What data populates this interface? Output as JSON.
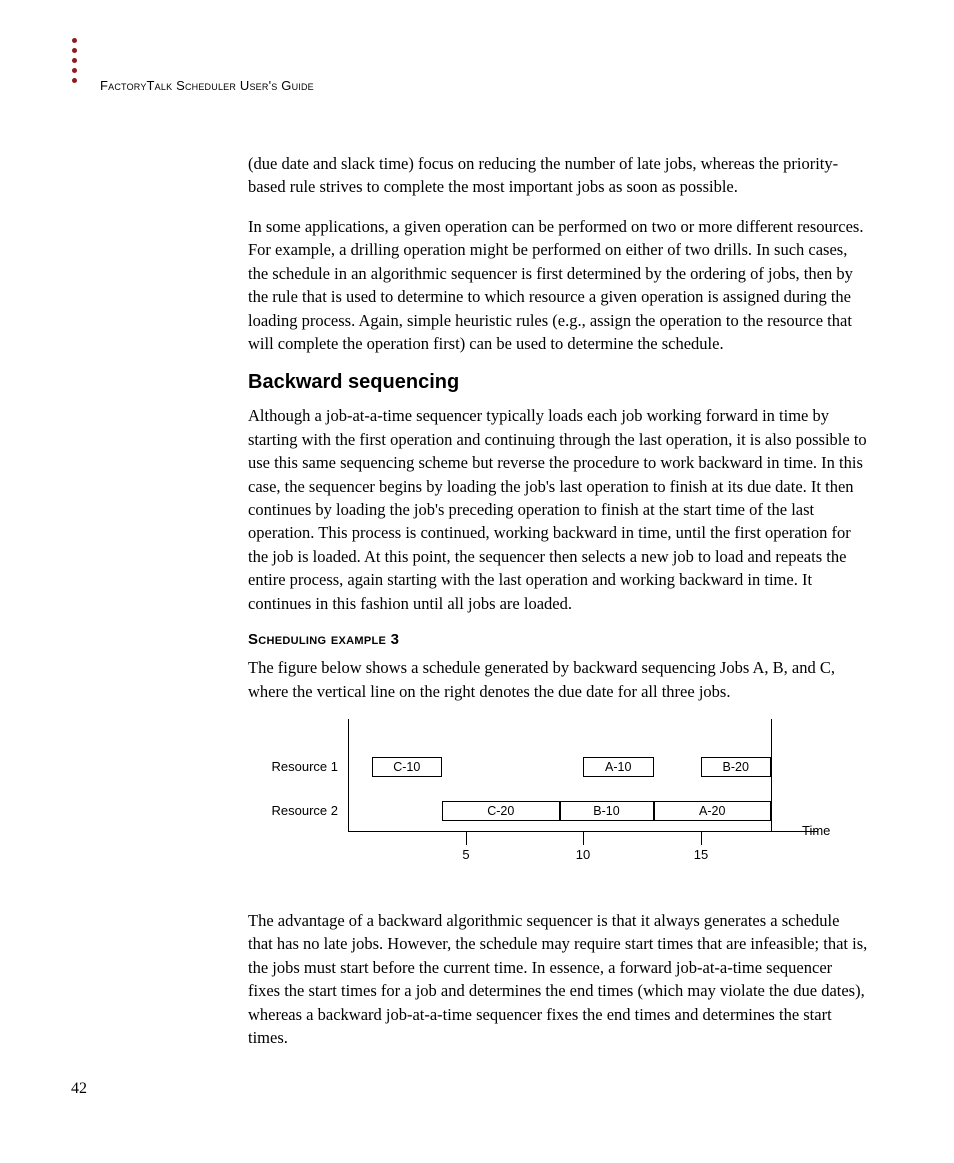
{
  "header": {
    "title": "FactoryTalk Scheduler User's Guide"
  },
  "body": {
    "para1": "(due date and slack time) focus on reducing the number of late jobs, whereas the priority-based rule strives to complete the most important jobs as soon as possible.",
    "para2": "In some applications, a given operation can be performed on two or more different resources. For example, a drilling operation might be performed on either of two drills. In such cases, the schedule in an algorithmic sequencer is first determined by the ordering of jobs, then by the rule that is used to determine to which resource a given operation is assigned during the loading process. Again, simple heuristic rules (e.g., assign the operation to the resource that will complete the operation first) can be used to determine the schedule.",
    "heading_backward": "Backward sequencing",
    "para3": "Although a job-at-a-time sequencer typically loads each job working forward in time by starting with the first operation and continuing through the last operation, it is also possible to use this same sequencing scheme but reverse the procedure to work backward in time. In this case, the sequencer begins by loading the job's last operation to finish at its due date. It then continues by loading the job's preceding operation to finish at the start time of the last operation. This process is continued, working backward in time, until the first operation for the job is loaded. At this point, the sequencer then selects a new job to load and repeats the entire process, again starting with the last operation and working backward in time. It continues in this fashion until all jobs are loaded.",
    "heading_example": "Scheduling example 3",
    "para4": "The figure below shows a schedule generated by backward sequencing Jobs A, B, and C, where the vertical line on the right denotes the due date for all three jobs.",
    "para5": "The advantage of a backward algorithmic sequencer is that it always generates a schedule that has no late jobs. However, the schedule may require start times that are infeasible; that is, the jobs must start before the current time. In essence, a forward job-at-a-time sequencer fixes the start times for a job and determines the end times (which may violate the due dates), whereas a backward job-at-a-time sequencer fixes the end times and determines the start times."
  },
  "page_number": "42",
  "chart_data": {
    "type": "bar",
    "title": "",
    "xlabel": "Time",
    "ylabel": "",
    "x_ticks": [
      5,
      10,
      15
    ],
    "due_date": 18,
    "resources": [
      "Resource 1",
      "Resource 2"
    ],
    "series": [
      {
        "resource": "Resource 1",
        "label": "C-10",
        "start": 1,
        "end": 4
      },
      {
        "resource": "Resource 1",
        "label": "A-10",
        "start": 10,
        "end": 13
      },
      {
        "resource": "Resource 1",
        "label": "B-20",
        "start": 15,
        "end": 18
      },
      {
        "resource": "Resource 2",
        "label": "C-20",
        "start": 4,
        "end": 9
      },
      {
        "resource": "Resource 2",
        "label": "B-10",
        "start": 9,
        "end": 13
      },
      {
        "resource": "Resource 2",
        "label": "A-20",
        "start": 13,
        "end": 18
      }
    ]
  }
}
